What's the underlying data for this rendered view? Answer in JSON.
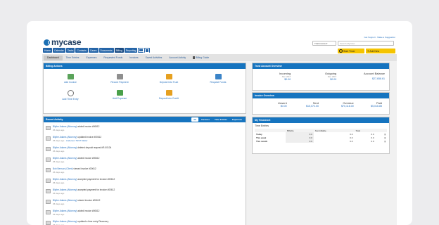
{
  "header": {
    "logo_text": "mycase",
    "top_links": "Get Support · Make a Suggestion",
    "trial_label": "Trial Invoice ▾",
    "search_placeholder": "Search MyCase",
    "start_timer": "Start Timer",
    "add_new": "Add New"
  },
  "nav": {
    "tabs": [
      "Home",
      "Calendar",
      "Tasks",
      "Contacts",
      "Cases",
      "Documents",
      "Billing",
      "Reporting"
    ],
    "active": "Billing"
  },
  "subnav": {
    "tabs": [
      "Dashboard",
      "Time Entries",
      "Expenses",
      "Requested Funds",
      "Invoices",
      "Saved Activities",
      "Account Activity",
      "Billing Guide"
    ],
    "active": "Dashboard"
  },
  "billing_actions": {
    "title": "Billing Actions",
    "items": [
      {
        "label": "Add Invoice",
        "icon": "invoice-icon",
        "color": "#5aa35a"
      },
      {
        "label": "Record Payment",
        "icon": "payment-icon",
        "color": "#8f8f8f"
      },
      {
        "label": "Deposit into Trust",
        "icon": "trust-icon",
        "color": "#e6a020"
      },
      {
        "label": "Request Funds",
        "icon": "request-funds-icon",
        "color": "#3b84c8"
      },
      {
        "label": "Add Time Entry",
        "icon": "clock-icon",
        "color": "#6f6f6f"
      },
      {
        "label": "Add Expense",
        "icon": "expense-icon",
        "color": "#4aa04a"
      },
      {
        "label": "Deposit into Credit",
        "icon": "credit-icon",
        "color": "#e6a020"
      }
    ]
  },
  "recent_activity": {
    "title": "Recent Activity",
    "tabs": [
      "All",
      "Invoices",
      "Time Entries",
      "Expenses"
    ],
    "items": [
      {
        "actor": "Blythe Adams (Attorney)",
        "action": "added invoice #00612",
        "time": "25 days ago",
        "link": ""
      },
      {
        "actor": "Blythe Adams (Attorney)",
        "action": "updated invoice #00612",
        "time": "25 days ago",
        "link": "Anderson TEST Matter"
      },
      {
        "actor": "Blythe Adams (Attorney)",
        "action": "deleted deposit request #R-00104",
        "time": "25 days ago",
        "link": ""
      },
      {
        "actor": "Blythe Adams (Attorney)",
        "action": "added invoice #00612",
        "time": "25 days ago",
        "link": ""
      },
      {
        "actor": "Bob Benson (Client)",
        "action": "viewed invoice #00612",
        "time": "25 days ago",
        "link": ""
      },
      {
        "actor": "Blythe Adams (Attorney)",
        "action": "accepted payment for invoice #00612",
        "time": "25 days ago",
        "link": ""
      },
      {
        "actor": "Blythe Adams (Attorney)",
        "action": "accepted payment for invoice #00612",
        "time": "25 days ago",
        "link": ""
      },
      {
        "actor": "Blythe Adams (Attorney)",
        "action": "shared invoice #00612",
        "time": "25 days ago",
        "link": ""
      },
      {
        "actor": "Blythe Adams (Attorney)",
        "action": "added invoice #00612",
        "time": "25 days ago",
        "link": ""
      },
      {
        "actor": "Blythe Adams (Attorney)",
        "action": "updated a time entry Discovery",
        "time": "25 days ago",
        "link": ""
      }
    ]
  },
  "trust_overview": {
    "title": "Trust Account Overview",
    "incoming_label": "Incoming",
    "incoming_period": "Nov. 2017",
    "incoming_value": "$0.00",
    "outgoing_label": "Outgoing",
    "outgoing_period": "Nov. 2017",
    "outgoing_value": "$0.00",
    "balance_label": "Account Balance",
    "balance_value": "$27,658.61"
  },
  "invoice_overview": {
    "title": "Invoice Overview",
    "cols": [
      {
        "label": "Unsent",
        "value": "$0.00"
      },
      {
        "label": "Sent",
        "value": "$15,072.00"
      },
      {
        "label": "Overdue",
        "value": "$70,116.00"
      },
      {
        "label": "Paid",
        "value": "$5,016.85"
      }
    ]
  },
  "timesheet": {
    "title": "My Timesheet",
    "section": "Time Entries",
    "headers": [
      "",
      "Billable",
      "Non-billable",
      "Total"
    ],
    "rows": [
      {
        "label": "Today",
        "billable": "0.0",
        "nonbillable": "0.0",
        "total": "0.0"
      },
      {
        "label": "This week",
        "billable": "0.0",
        "nonbillable": "0.0",
        "total": "0.0"
      },
      {
        "label": "This month",
        "billable": "0.0",
        "nonbillable": "0.0",
        "total": "0.0"
      }
    ]
  },
  "colors": {
    "nav_blue": "#2565a8",
    "panel_header": "#1674bf",
    "accent_yellow": "#f5c400",
    "link": "#2a73c0"
  }
}
